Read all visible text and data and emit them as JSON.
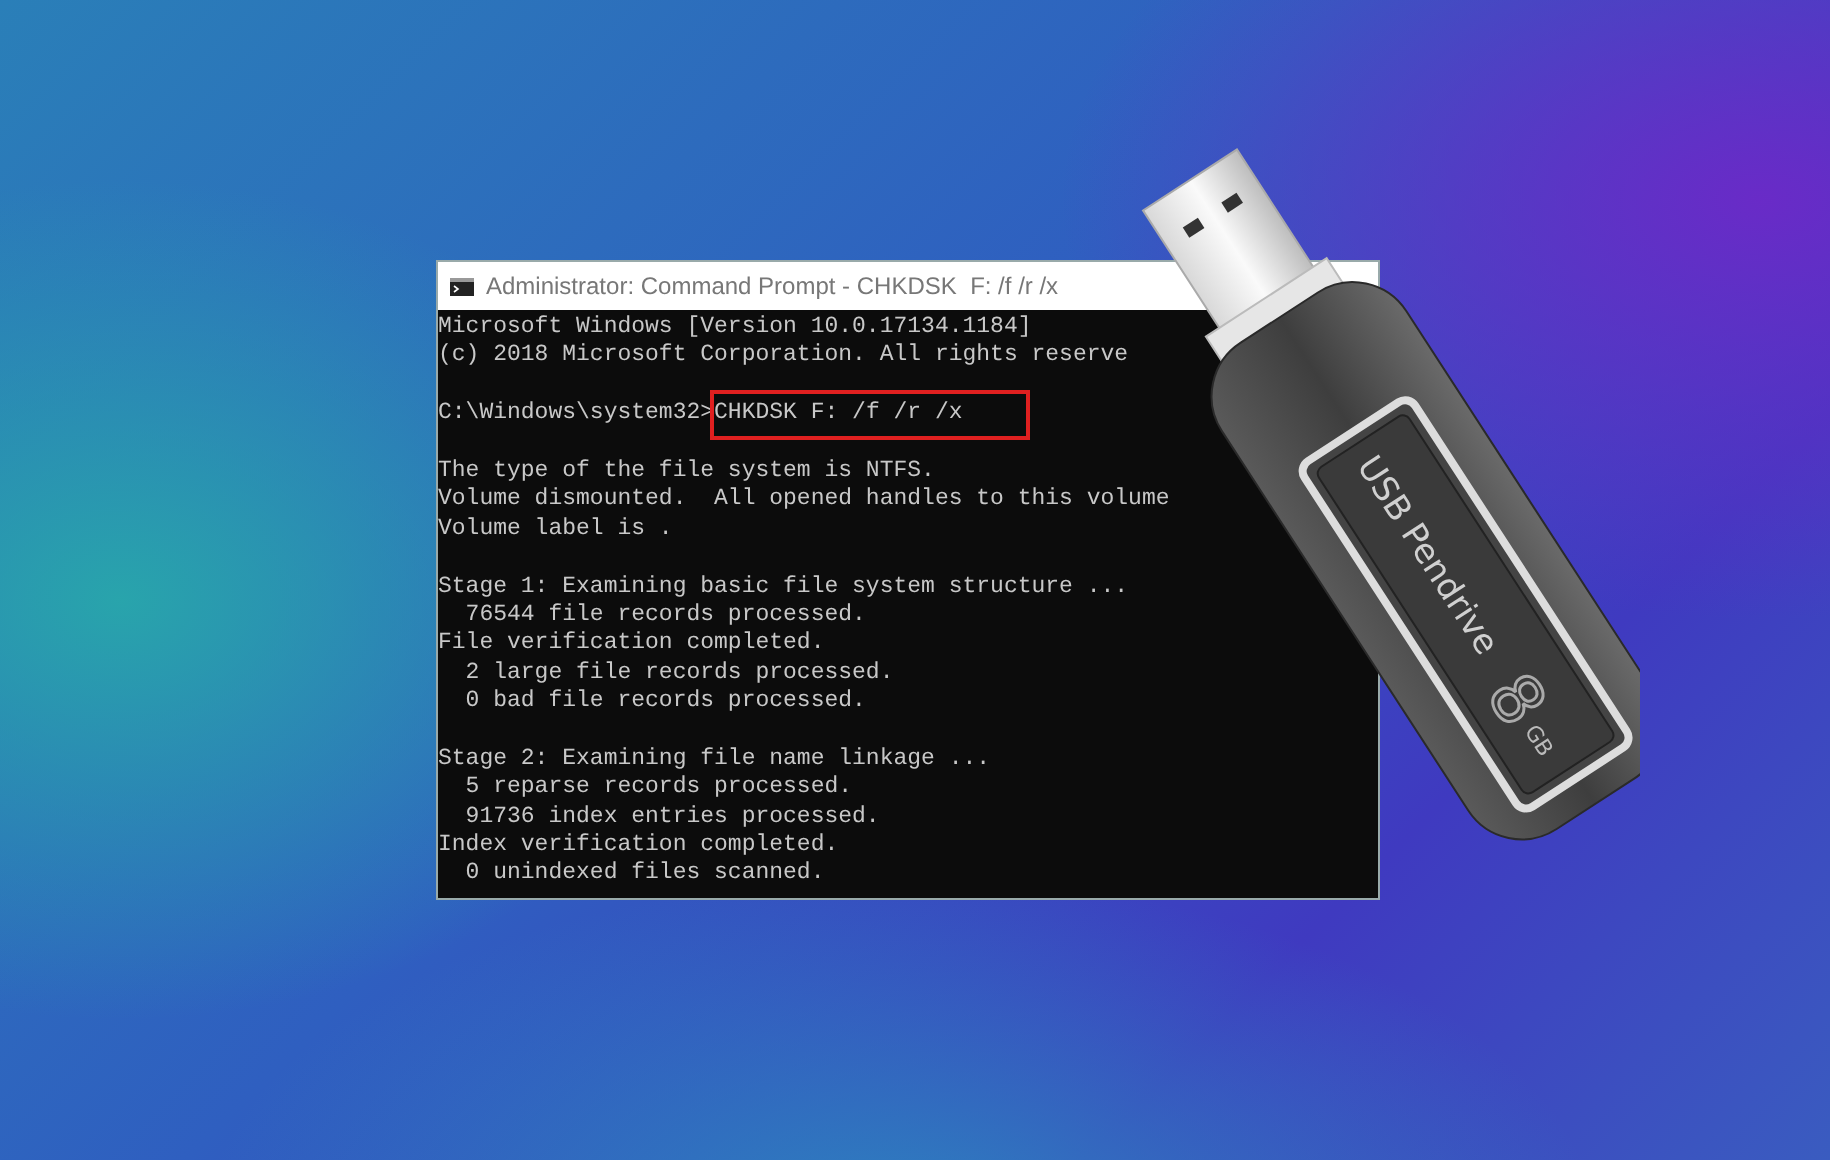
{
  "window": {
    "title": "Administrator: Command Prompt - CHKDSK  F: /f /r /x",
    "lines": [
      {
        "kind": "output",
        "text": "Microsoft Windows [Version 10.0.17134.1184]"
      },
      {
        "kind": "output",
        "text": "(c) 2018 Microsoft Corporation. All rights reserve"
      },
      {
        "kind": "blank"
      },
      {
        "kind": "prompt",
        "prompt": "C:\\Windows\\system32>",
        "command": "CHKDSK F: /f /r /x",
        "highlighted": true
      },
      {
        "kind": "blank"
      },
      {
        "kind": "output",
        "text": "The type of the file system is NTFS."
      },
      {
        "kind": "output",
        "text": "Volume dismounted.  All opened handles to this volume"
      },
      {
        "kind": "output",
        "text": "Volume label is ."
      },
      {
        "kind": "blank"
      },
      {
        "kind": "output",
        "text": "Stage 1: Examining basic file system structure ..."
      },
      {
        "kind": "output",
        "text": "  76544 file records processed."
      },
      {
        "kind": "output",
        "text": "File verification completed."
      },
      {
        "kind": "output",
        "text": "  2 large file records processed."
      },
      {
        "kind": "output",
        "text": "  0 bad file records processed."
      },
      {
        "kind": "blank"
      },
      {
        "kind": "output",
        "text": "Stage 2: Examining file name linkage ..."
      },
      {
        "kind": "output",
        "text": "  5 reparse records processed."
      },
      {
        "kind": "output",
        "text": "  91736 index entries processed."
      },
      {
        "kind": "output",
        "text": "Index verification completed."
      },
      {
        "kind": "output",
        "text": "  0 unindexed files scanned."
      }
    ]
  },
  "usb_drive": {
    "label": "USB Pendrive",
    "capacity": "8",
    "unit": "GB"
  }
}
